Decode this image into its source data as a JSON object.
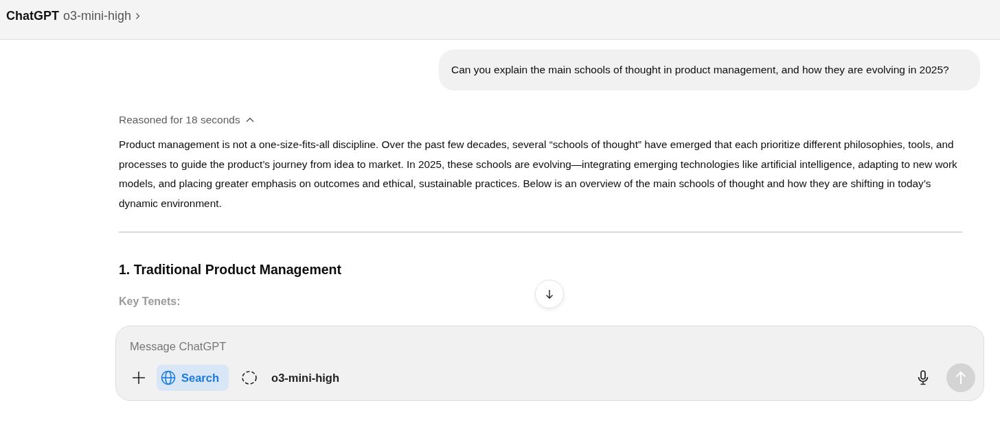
{
  "header": {
    "app_name": "ChatGPT",
    "model": "o3-mini-high"
  },
  "user_message": "Can you explain the main schools of thought in product management, and how they are evolving in 2025?",
  "reasoning": {
    "label": "Reasoned for 18 seconds",
    "expanded": true
  },
  "answer": {
    "paragraph": "Product management is not a one-size-fits-all discipline. Over the past few decades, several “schools of thought” have emerged that each prioritize different philosophies, tools, and processes to guide the product’s journey from idea to market. In 2025, these schools are evolving—integrating emerging technologies like artificial intelligence, adapting to new work models, and placing greater emphasis on outcomes and ethical, sustainable practices. Below is an overview of the main schools of thought and how they are shifting in today’s dynamic environment.",
    "heading": "1. Traditional Product Management",
    "subheading": "Key Tenets:"
  },
  "composer": {
    "placeholder": "Message ChatGPT",
    "search": {
      "label": "Search",
      "selected": true
    },
    "model": "o3-mini-high",
    "send_disabled": true
  }
}
